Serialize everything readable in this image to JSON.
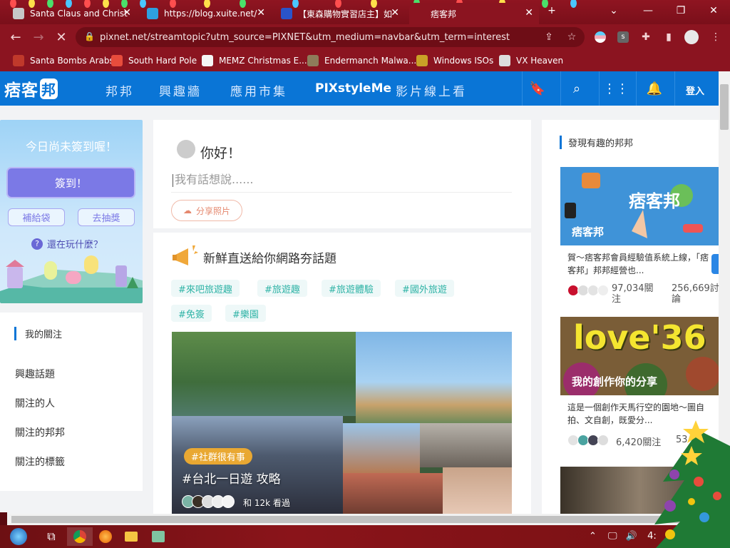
{
  "browser": {
    "tabs": [
      {
        "title": "Santa Claus and Christ",
        "active": false
      },
      {
        "title": "https://blog.xuite.net/",
        "active": false
      },
      {
        "title": "【東森購物實習店主】如",
        "active": false
      },
      {
        "title": "痞客邦",
        "active": true
      }
    ],
    "new_tab": "+",
    "window_controls": {
      "dropdown": "⌄",
      "minimize": "—",
      "restore": "❐",
      "close": "✕"
    },
    "url": "pixnet.net/streamtopic?utm_source=PIXNET&utm_medium=navbar&utm_term=interest",
    "bookmarks": [
      {
        "label": "Santa Bombs Arabs",
        "color": "#c0392b"
      },
      {
        "label": "South Hard Pole",
        "color": "#e74c3c"
      },
      {
        "label": "MEMZ Christmas E...",
        "color": "#f5f5f5"
      },
      {
        "label": "Endermanch Malwa...",
        "color": "#8e7c5a"
      },
      {
        "label": "Windows ISOs",
        "color": "#c9a227"
      },
      {
        "label": "VX Heaven",
        "color": "#dddddd"
      }
    ]
  },
  "pixnet": {
    "logo_main": "痞客",
    "logo_bubble": "邦",
    "nav": [
      "邦邦",
      "興趣牆",
      "應用市集",
      "PIXstyleMe",
      "影片線上看"
    ],
    "login": "登入",
    "accent": "#0a75d6"
  },
  "left": {
    "checkin_title": "今日尚未簽到喔！",
    "checkin_button": "簽到！",
    "buttons": [
      "補給袋",
      "去抽獎"
    ],
    "help": "還在玩什麼？",
    "follow_heading": "我的關注",
    "menu": [
      "興趣話題",
      "關注的人",
      "關注的邦邦",
      "關注的標籤"
    ]
  },
  "middle": {
    "greeting": "你好！",
    "compose_placeholder": "我有話想說......",
    "share_photo": "分享照片",
    "topic_title": "新鮮直送給你網路夯話題",
    "tags": [
      "#來吧旅遊趣",
      "#旅遊趣",
      "#旅遊體驗",
      "#國外旅遊",
      "#免簽",
      "#樂園"
    ],
    "collage_tag": "#社群很有事",
    "collage_title": "#台北一日遊 攻略",
    "viewers": "和 12k 看過"
  },
  "right": {
    "heading": "發現有趣的邦邦",
    "cards": [
      {
        "banner_text": "痞客邦",
        "desc": "賀～痞客邦會員經驗值系統上線，「痞客邦」邦邦經營也...",
        "followers": "97,034關注",
        "posts": "256,669討論"
      },
      {
        "banner_text": "我的創作你的分享",
        "banner_big": "love'36",
        "desc": "這是一個創作天馬行空的園地～圖自拍、文自創，既愛分...",
        "followers": "6,420關注",
        "posts": "53"
      }
    ]
  },
  "taskbar": {
    "clock_partial": "4:"
  }
}
